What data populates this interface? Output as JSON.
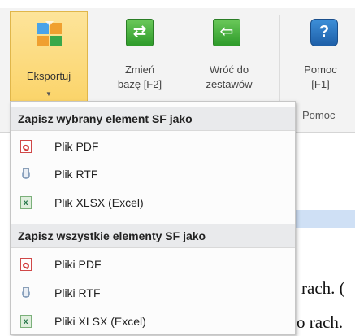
{
  "ribbon": {
    "export_label": "Eksportuj",
    "export_arrow": "▼",
    "change_db_label_1": "Zmień",
    "change_db_label_2": "bazę [F2]",
    "back_label_1": "Wróć do",
    "back_label_2": "zestawów",
    "help_label_1": "Pomoc",
    "help_label_2": "[F1]",
    "help_group_label": "Pomoc",
    "icons": {
      "change_db": "swap-arrows-icon",
      "back": "back-arrow-icon",
      "help": "question-mark-icon"
    }
  },
  "menu": {
    "section1_header": "Zapisz wybrany element SF jako",
    "section1_items": [
      "Plik PDF",
      "Plik RTF",
      "Plik XLSX (Excel)"
    ],
    "section2_header": "Zapisz wszystkie elementy SF jako",
    "section2_items": [
      "Pliki PDF",
      "Pliki RTF",
      "Pliki XLSX (Excel)"
    ]
  },
  "background": {
    "right_text_1": "rach. (",
    "right_text_2": "o rach."
  },
  "colors": {
    "export_highlight": "#fbd46a",
    "menu_header_bg": "#e9eaec",
    "green_icon": "#2e9b2a",
    "blue_icon": "#1e5fa8"
  }
}
